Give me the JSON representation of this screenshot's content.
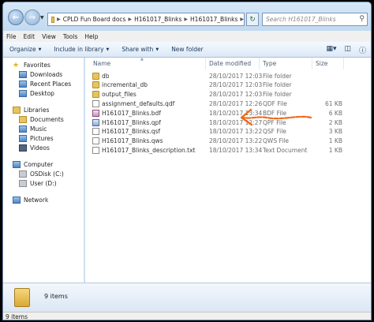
{
  "address_bar": {
    "crumbs": [
      "CPLD Fun Board docs",
      "H161017_Blinks",
      "H161017_Blinks"
    ],
    "search_placeholder": "Search H161017_Blinks"
  },
  "menu": [
    "File",
    "Edit",
    "View",
    "Tools",
    "Help"
  ],
  "toolbar": {
    "organize": "Organize",
    "include_in_library": "Include in library",
    "share_with": "Share with",
    "new_folder": "New folder"
  },
  "nav": {
    "favorites": "Favorites",
    "favorites_items": [
      "Downloads",
      "Recent Places",
      "Desktop"
    ],
    "libraries": "Libraries",
    "libraries_items": [
      "Documents",
      "Music",
      "Pictures",
      "Videos"
    ],
    "computer": "Computer",
    "computer_items": [
      "OSDisk (C:)",
      "User (D:)"
    ],
    "network": "Network"
  },
  "columns": {
    "name": "Name",
    "date": "Date modified",
    "type": "Type",
    "size": "Size"
  },
  "files": [
    {
      "name": "db",
      "date": "28/10/2017 12:03",
      "type": "File folder",
      "size": "",
      "icon": "folder-icon"
    },
    {
      "name": "incremental_db",
      "date": "28/10/2017 12:03",
      "type": "File folder",
      "size": "",
      "icon": "folder-icon"
    },
    {
      "name": "output_files",
      "date": "28/10/2017 12:03",
      "type": "File folder",
      "size": "",
      "icon": "folder-icon"
    },
    {
      "name": "assignment_defaults.qdf",
      "date": "28/10/2017 12:26",
      "type": "QDF File",
      "size": "61 KB",
      "icon": "file-icon"
    },
    {
      "name": "H161017_Blinks.bdf",
      "date": "18/10/2017 13:34",
      "type": "BDF File",
      "size": "6 KB",
      "icon": "bdf-file-icon"
    },
    {
      "name": "H161017_Blinks.qpf",
      "date": "18/10/2017 12:27",
      "type": "QPF File",
      "size": "2 KB",
      "icon": "qpf-file-icon"
    },
    {
      "name": "H161017_Blinks.qsf",
      "date": "18/10/2017 13:22",
      "type": "QSF File",
      "size": "3 KB",
      "icon": "file-icon"
    },
    {
      "name": "H161017_Blinks.qws",
      "date": "28/10/2017 13:22",
      "type": "QWS File",
      "size": "1 KB",
      "icon": "file-icon"
    },
    {
      "name": "H161017_Blinks_description.txt",
      "date": "18/10/2017 13:34",
      "type": "Text Document",
      "size": "1 KB",
      "icon": "text-file-icon"
    }
  ],
  "details_count": "9 items",
  "status_text": "9 items",
  "colors": {
    "annotation_arrow": "#f06a1c",
    "window_frame": "#c9dff2"
  }
}
